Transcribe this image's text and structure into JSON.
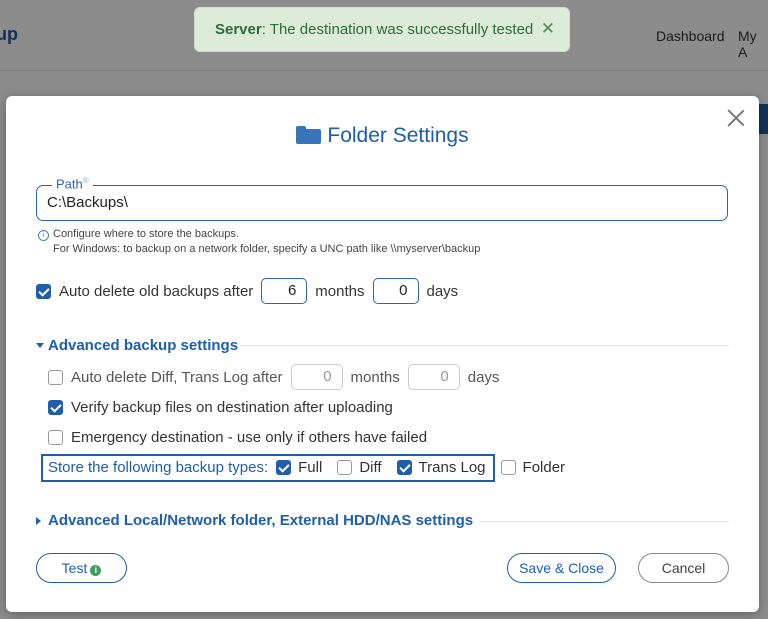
{
  "background": {
    "logo_text": "up",
    "nav": [
      "Dashboard",
      "My A"
    ]
  },
  "toast": {
    "prefix": "Server",
    "message": ": The destination was successfully tested",
    "close_glyph": "✕"
  },
  "modal": {
    "title": "Folder Settings",
    "icon": "folder-icon",
    "path": {
      "label": "Path",
      "required_mark": "®",
      "value": "C:\\Backups\\",
      "hint_line1": "Configure where to store the backups.",
      "hint_line2": "For Windows: to backup on a network folder, specify a UNC path like \\\\myserver\\backup"
    },
    "auto_delete": {
      "checked": true,
      "label": "Auto delete old backups after",
      "months_value": "6",
      "months_label": "months",
      "days_value": "0",
      "days_label": "days"
    },
    "advanced": {
      "heading": "Advanced backup settings",
      "auto_delete_diff": {
        "checked": false,
        "label": "Auto delete Diff, Trans Log after",
        "months_value": "0",
        "months_label": "months",
        "days_value": "0",
        "days_label": "days"
      },
      "verify": {
        "checked": true,
        "label": "Verify backup files on destination after uploading"
      },
      "emergency": {
        "checked": false,
        "label": "Emergency destination - use only if others have failed"
      },
      "types": {
        "label": "Store the following backup types:",
        "full": {
          "label": "Full",
          "checked": true
        },
        "diff": {
          "label": "Diff",
          "checked": false
        },
        "trans_log": {
          "label": "Trans Log",
          "checked": true
        },
        "folder": {
          "label": "Folder",
          "checked": false
        }
      }
    },
    "advanced_local": {
      "heading": "Advanced Local/Network folder, External HDD/NAS settings"
    },
    "buttons": {
      "test": "Test",
      "save_close": "Save & Close",
      "cancel": "Cancel"
    }
  },
  "colors": {
    "accent": "#1f5ea8",
    "toast_bg": "#dcecd9",
    "toast_text": "#2f6b3b"
  }
}
